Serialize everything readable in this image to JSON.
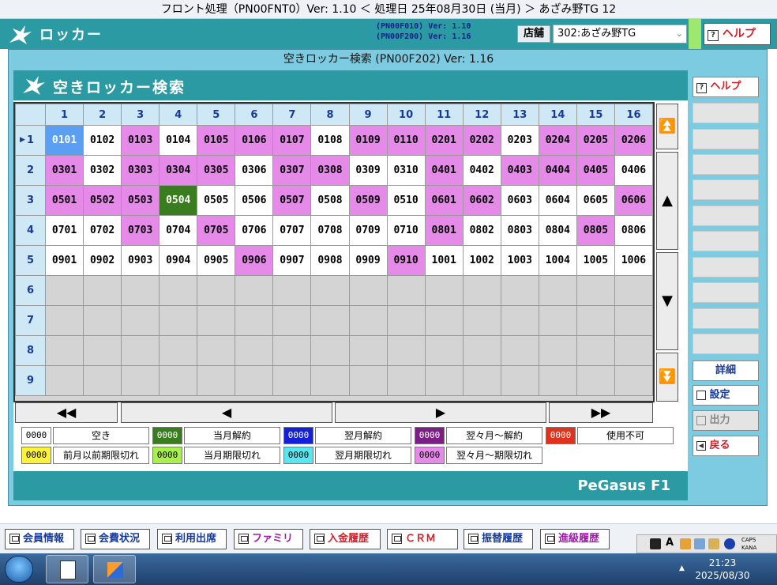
{
  "window": {
    "title": "フロント処理（PN00FNT0）Ver: 1.10 ＜ 処理日 25年08月30日 (当月) ＞ あざみ野TG 12"
  },
  "app": {
    "title": "ロッカー",
    "versions": [
      "(PN00F010)  Ver: 1.10",
      "(PN00F200)  Ver: 1.16"
    ],
    "store_label": "店舗",
    "store_value": "302:あざみ野TG",
    "help_label": "ヘルプ"
  },
  "dialog": {
    "title": "空きロッカー検索 (PN00F202) Ver: 1.16",
    "panel_title": "空きロッカー検索",
    "brand": "PeGasus F1"
  },
  "grid": {
    "columns": [
      "1",
      "2",
      "3",
      "4",
      "5",
      "6",
      "7",
      "8",
      "9",
      "10",
      "11",
      "12",
      "13",
      "14",
      "15",
      "16"
    ],
    "row_labels": [
      "1",
      "2",
      "3",
      "4",
      "5",
      "6",
      "7",
      "8",
      "9"
    ],
    "rows": [
      [
        [
          "0101",
          3
        ],
        [
          "0102",
          0
        ],
        [
          "0103",
          1
        ],
        [
          "0104",
          0
        ],
        [
          "0105",
          1
        ],
        [
          "0106",
          1
        ],
        [
          "0107",
          1
        ],
        [
          "0108",
          0
        ],
        [
          "0109",
          1
        ],
        [
          "0110",
          1
        ],
        [
          "0201",
          1
        ],
        [
          "0202",
          1
        ],
        [
          "0203",
          0
        ],
        [
          "0204",
          1
        ],
        [
          "0205",
          1
        ],
        [
          "0206",
          1
        ]
      ],
      [
        [
          "0301",
          1
        ],
        [
          "0302",
          0
        ],
        [
          "0303",
          1
        ],
        [
          "0304",
          1
        ],
        [
          "0305",
          1
        ],
        [
          "0306",
          0
        ],
        [
          "0307",
          1
        ],
        [
          "0308",
          1
        ],
        [
          "0309",
          0
        ],
        [
          "0310",
          0
        ],
        [
          "0401",
          1
        ],
        [
          "0402",
          0
        ],
        [
          "0403",
          1
        ],
        [
          "0404",
          1
        ],
        [
          "0405",
          1
        ],
        [
          "0406",
          0
        ]
      ],
      [
        [
          "0501",
          1
        ],
        [
          "0502",
          1
        ],
        [
          "0503",
          1
        ],
        [
          "0504",
          2
        ],
        [
          "0505",
          0
        ],
        [
          "0506",
          0
        ],
        [
          "0507",
          1
        ],
        [
          "0508",
          0
        ],
        [
          "0509",
          1
        ],
        [
          "0510",
          0
        ],
        [
          "0601",
          1
        ],
        [
          "0602",
          1
        ],
        [
          "0603",
          0
        ],
        [
          "0604",
          0
        ],
        [
          "0605",
          0
        ],
        [
          "0606",
          1
        ]
      ],
      [
        [
          "0701",
          0
        ],
        [
          "0702",
          0
        ],
        [
          "0703",
          1
        ],
        [
          "0704",
          0
        ],
        [
          "0705",
          1
        ],
        [
          "0706",
          0
        ],
        [
          "0707",
          0
        ],
        [
          "0708",
          0
        ],
        [
          "0709",
          0
        ],
        [
          "0710",
          0
        ],
        [
          "0801",
          1
        ],
        [
          "0802",
          0
        ],
        [
          "0803",
          0
        ],
        [
          "0804",
          0
        ],
        [
          "0805",
          1
        ],
        [
          "0806",
          0
        ]
      ],
      [
        [
          "0901",
          0
        ],
        [
          "0902",
          0
        ],
        [
          "0903",
          0
        ],
        [
          "0904",
          0
        ],
        [
          "0905",
          0
        ],
        [
          "0906",
          1
        ],
        [
          "0907",
          0
        ],
        [
          "0908",
          0
        ],
        [
          "0909",
          0
        ],
        [
          "0910",
          1
        ],
        [
          "1001",
          0
        ],
        [
          "1002",
          0
        ],
        [
          "1003",
          0
        ],
        [
          "1004",
          0
        ],
        [
          "1005",
          0
        ],
        [
          "1006",
          0
        ]
      ]
    ],
    "cell_colors": [
      "#ffffff",
      "#e58ae9",
      "#3a7d1f",
      "#5b9ff5"
    ]
  },
  "legend": [
    [
      {
        "code": "0000",
        "bg": "#ffffff",
        "fg": "#000000",
        "label": "空き"
      },
      {
        "code": "0000",
        "bg": "#3a7d1f",
        "fg": "#ffffff",
        "label": "当月解約"
      },
      {
        "code": "0000",
        "bg": "#1320d6",
        "fg": "#ffffff",
        "label": "翌月解約"
      },
      {
        "code": "0000",
        "bg": "#7b1f86",
        "fg": "#ffffff",
        "label": "翌々月～解約"
      },
      {
        "code": "0000",
        "bg": "#e0321c",
        "fg": "#ffffff",
        "label": "使用不可"
      }
    ],
    [
      {
        "code": "0000",
        "bg": "#fdf23a",
        "fg": "#000000",
        "label": "前月以前期限切れ"
      },
      {
        "code": "0000",
        "bg": "#a9f04d",
        "fg": "#000000",
        "label": "当月期限切れ"
      },
      {
        "code": "0000",
        "bg": "#58e6f0",
        "fg": "#000000",
        "label": "翌月期限切れ"
      },
      {
        "code": "0000",
        "bg": "#e58ae9",
        "fg": "#000000",
        "label": "翌々月～期限切れ"
      }
    ]
  ],
  "side": {
    "help": "ヘルプ",
    "detail": "詳細",
    "settings": "設定",
    "output": "出力",
    "back": "戻る"
  },
  "function_bar": [
    {
      "label": "会員情報",
      "color": "#163a9a"
    },
    {
      "label": "会費状況",
      "color": "#163a9a"
    },
    {
      "label": "利用出席",
      "color": "#163a9a"
    },
    {
      "label": "ファミリー",
      "color": "#9b1fa6"
    },
    {
      "label": "入金履歴",
      "color": "#d0212b"
    },
    {
      "label": "ＣＲＭ",
      "color": "#d0212b"
    },
    {
      "label": "振替履歴",
      "color": "#163a9a"
    },
    {
      "label": "進級履歴",
      "color": "#9b1fa6"
    }
  ],
  "tray": {
    "caps": "CAPS",
    "kana": "KANA",
    "ime": "A"
  },
  "clock": {
    "time": "21:23",
    "date": "2025/08/30"
  }
}
